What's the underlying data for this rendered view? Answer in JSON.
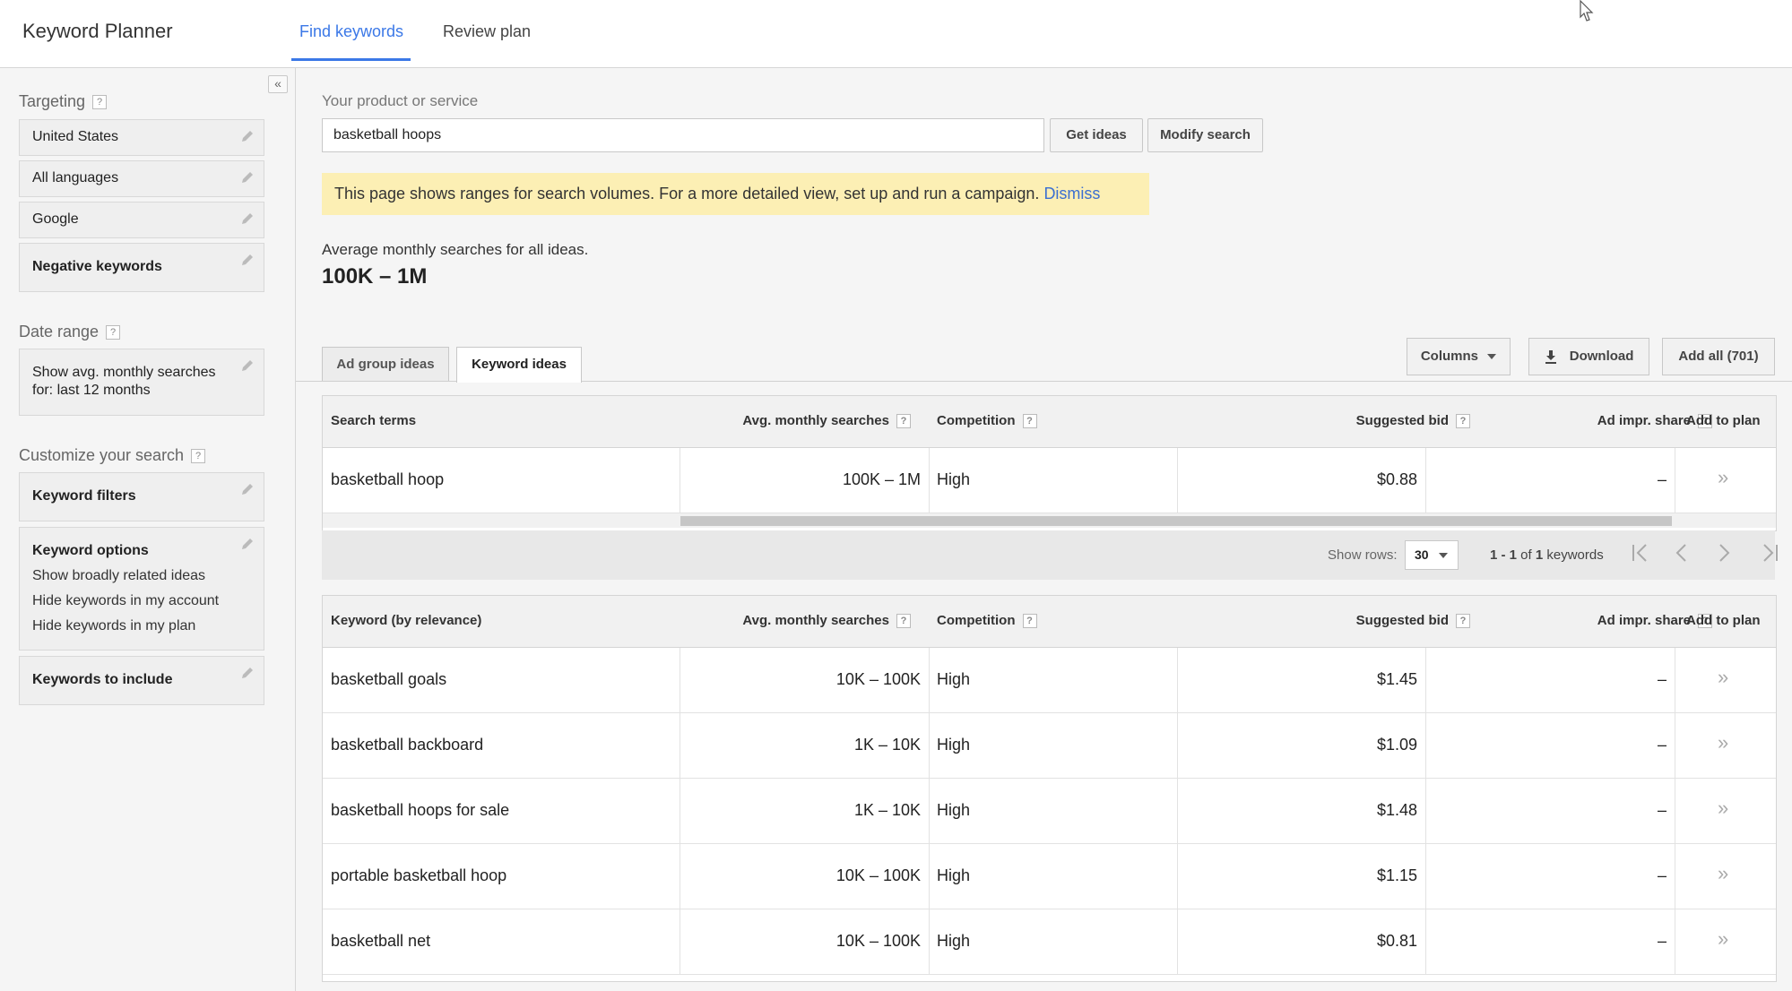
{
  "header": {
    "app_title": "Keyword Planner",
    "tabs": [
      {
        "label": "Find keywords",
        "active": true
      },
      {
        "label": "Review plan",
        "active": false
      }
    ]
  },
  "sidebar": {
    "collapse_label": "«",
    "targeting": {
      "heading": "Targeting",
      "help": "?",
      "items": [
        "United States",
        "All languages",
        "Google"
      ],
      "negative_keywords": "Negative keywords"
    },
    "date_range": {
      "heading": "Date range",
      "help": "?",
      "line1": "Show avg. monthly searches",
      "line2": "for: last 12 months"
    },
    "customize": {
      "heading": "Customize your search",
      "help": "?",
      "keyword_filters": "Keyword filters",
      "keyword_options": {
        "title": "Keyword options",
        "lines": [
          "Show broadly related ideas",
          "Hide keywords in my account",
          "Hide keywords in my plan"
        ]
      },
      "keywords_to_include": "Keywords to include"
    }
  },
  "search": {
    "label": "Your product or service",
    "value": "basketball hoops",
    "get_ideas": "Get ideas",
    "modify_search": "Modify search"
  },
  "notice": {
    "text": "This page shows ranges for search volumes. For a more detailed view, set up and run a campaign.",
    "dismiss": "Dismiss"
  },
  "summary": {
    "label": "Average monthly searches for all ideas.",
    "value": "100K – 1M"
  },
  "idea_tabs": [
    {
      "label": "Ad group ideas",
      "active": false
    },
    {
      "label": "Keyword ideas",
      "active": true
    }
  ],
  "toolbar": {
    "columns": "Columns",
    "download": "Download",
    "add_all": "Add all (701)"
  },
  "search_terms_table": {
    "headers": {
      "term": "Search terms",
      "avg": "Avg. monthly searches",
      "competition": "Competition",
      "bid": "Suggested bid",
      "impr": "Ad impr. share",
      "add": "Add to plan"
    },
    "rows": [
      {
        "term": "basketball hoop",
        "avg": "100K – 1M",
        "competition": "High",
        "bid": "$0.88",
        "impr": "–",
        "add": "»"
      }
    ]
  },
  "pager": {
    "show_rows_label": "Show rows:",
    "rows_value": "30",
    "count_prefix": "1 - 1",
    "count_of": " of ",
    "count_total": "1",
    "count_suffix": " keywords"
  },
  "keyword_table": {
    "headers": {
      "term": "Keyword (by relevance)",
      "avg": "Avg. monthly searches",
      "competition": "Competition",
      "bid": "Suggested bid",
      "impr": "Ad impr. share",
      "add": "Add to plan"
    },
    "help": "?",
    "rows": [
      {
        "term": "basketball goals",
        "avg": "10K – 100K",
        "competition": "High",
        "bid": "$1.45",
        "impr": "–",
        "add": "»"
      },
      {
        "term": "basketball backboard",
        "avg": "1K – 10K",
        "competition": "High",
        "bid": "$1.09",
        "impr": "–",
        "add": "»"
      },
      {
        "term": "basketball hoops for sale",
        "avg": "1K – 10K",
        "competition": "High",
        "bid": "$1.48",
        "impr": "–",
        "add": "»"
      },
      {
        "term": "portable basketball hoop",
        "avg": "10K – 100K",
        "competition": "High",
        "bid": "$1.15",
        "impr": "–",
        "add": "»"
      },
      {
        "term": "basketball net",
        "avg": "10K – 100K",
        "competition": "High",
        "bid": "$0.81",
        "impr": "–",
        "add": "»"
      }
    ]
  }
}
